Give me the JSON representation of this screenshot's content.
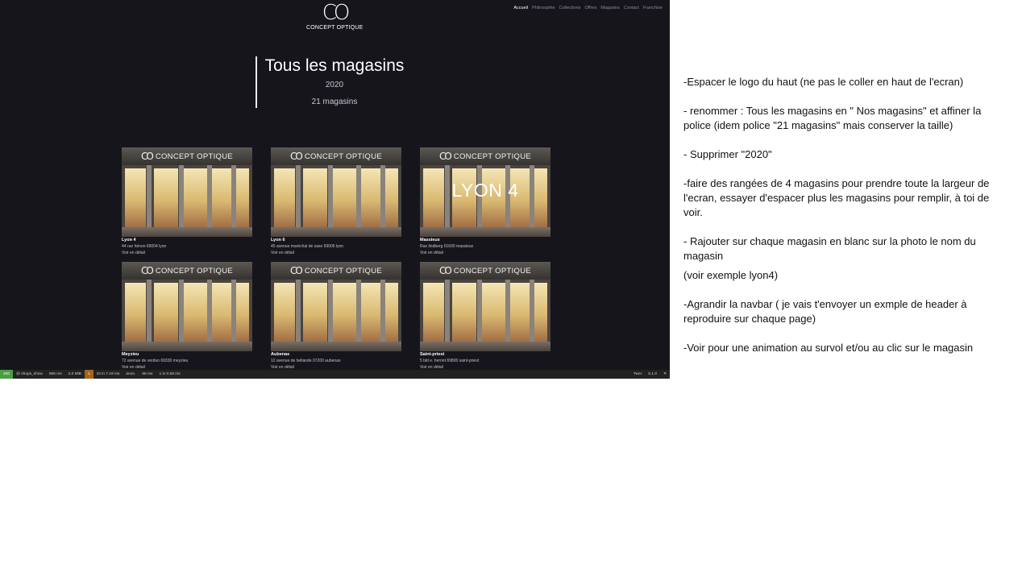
{
  "site": {
    "logo_mark": "CO",
    "logo_word": "CONCEPT OPTIQUE",
    "nav": [
      "Accueil",
      "Philosophie",
      "Collections",
      "Offres",
      "Magasins",
      "Contact",
      "Franchise"
    ],
    "active_nav": "Accueil"
  },
  "heading": {
    "title": "Tous les magasins",
    "year": "2020",
    "count": "21 magasins"
  },
  "sign": {
    "mark": "CO",
    "text": "CONCEPT OPTIQUE"
  },
  "overlay_example": "LYON 4",
  "stores": [
    {
      "name": "Lyon 4",
      "address": "44 rue hénon 69004 lyon",
      "link": "Voir en détail"
    },
    {
      "name": "Lyon 6",
      "address": "45 avenue maréchal de saxe 69006 lyon",
      "link": "Voir en détail"
    },
    {
      "name": "Massieux",
      "address": "Rue lindberg 01600 massieux",
      "link": "Voir en détail"
    },
    {
      "name": "Meyzieu",
      "address": "72 avenue de verdun 69330 meyzieu",
      "link": "Voir en détail"
    },
    {
      "name": "Aubenas",
      "address": "12 avenue de bellande 07200 aubenas",
      "link": "Voir en détail"
    },
    {
      "name": "Saint-priest",
      "address": "5 bld e. herriot 69800 saint-priest",
      "link": "Voir en détail"
    }
  ],
  "devbar": {
    "status": "200",
    "route": "@ shops_show",
    "time": "686 ms",
    "memory": "2.0 MiB",
    "badge": "1",
    "db": "22 in 7.19 ms",
    "user": "anon.",
    "mail": "68 ms",
    "cache": "1 in 0.59 ms",
    "twig": "Twer",
    "symfony": "5.1.0",
    "close": "✕"
  },
  "notes": [
    "-Espacer le logo du haut (ne pas le coller en haut de l'ecran)",
    "- renommer : Tous les magasins en \" Nos magasins\" et affiner la police (idem police \"21 magasins\" mais conserver la taille)",
    "- Supprimer \"2020\"",
    "-faire des rangées de 4 magasins pour prendre toute la largeur de l'ecran, essayer d'espacer plus les magasins pour remplir, à toi de voir.",
    "- Rajouter sur chaque magasin en blanc sur la photo le nom du magasin",
    "(voir exemple lyon4)",
    "-Agrandir la navbar ( je vais t'envoyer un exmple de header à reproduire sur chaque page)",
    "-Voir pour une animation au survol et/ou au clic sur le magasin"
  ]
}
